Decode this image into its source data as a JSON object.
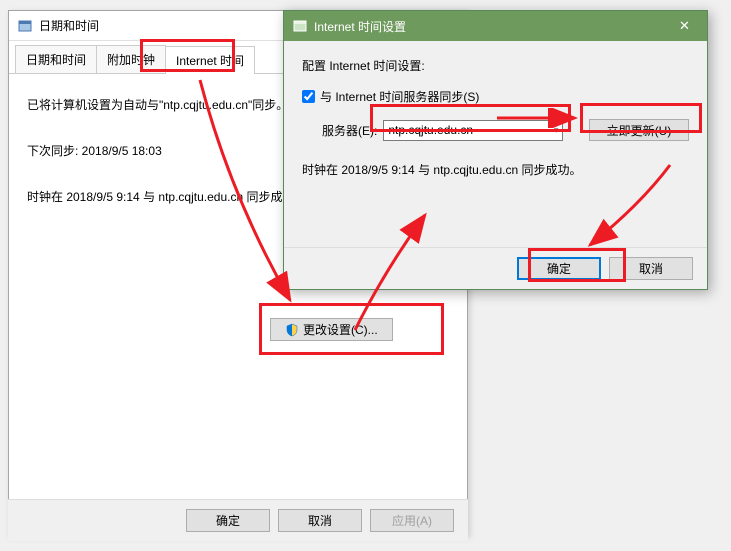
{
  "bgWindow": {
    "title": "日期和时间",
    "tabs": [
      "日期和时间",
      "附加时钟",
      "Internet 时间"
    ],
    "content": {
      "line1": "已将计算机设置为自动与\"ntp.cqjtu.edu.cn\"同步。",
      "line2": "下次同步: 2018/9/5 18:03",
      "line3": "时钟在 2018/9/5 9:14 与 ntp.cqjtu.edu.cn 同步成功。"
    },
    "changeBtn": "更改设置(C)...",
    "okBtn": "确定",
    "cancelBtn": "取消",
    "applyBtn": "应用(A)"
  },
  "dialog": {
    "title": "Internet 时间设置",
    "configLabel": "配置 Internet 时间设置:",
    "syncCheckbox": "与 Internet 时间服务器同步(S)",
    "serverLabel": "服务器(E):",
    "serverValue": "ntp.cqjtu.edu.cn",
    "updateBtn": "立即更新(U)",
    "statusText": "时钟在 2018/9/5 9:14 与 ntp.cqjtu.edu.cn 同步成功。",
    "okBtn": "确定",
    "cancelBtn": "取消"
  }
}
